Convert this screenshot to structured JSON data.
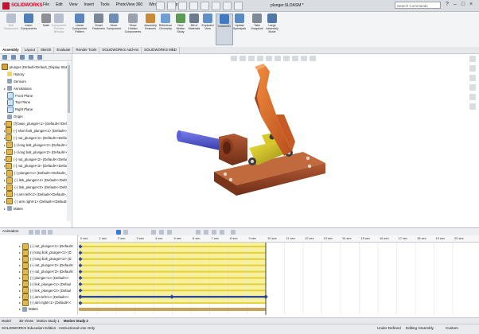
{
  "app": {
    "brand": "SOLIDWORKS",
    "doc_title": "plunger.SLDASM *",
    "search_placeholder": "Search Commands",
    "menu": [
      "File",
      "Edit",
      "View",
      "Insert",
      "Tools",
      "PhotoView 360",
      "Window",
      "Help"
    ],
    "window_buttons": [
      "?",
      "–",
      "□",
      "×"
    ]
  },
  "ribbon": {
    "commands": [
      {
        "label": "Edit\nComponent",
        "color": "#b7c0cc",
        "disabled": true
      },
      {
        "label": "Insert\nComponents",
        "color": "#4f7fb8",
        "disabled": false
      },
      {
        "label": "Mate",
        "color": "#8c8f96",
        "disabled": false
      },
      {
        "label": "Component\nPreview\nWindow",
        "color": "#b7c0cc",
        "disabled": true
      },
      {
        "label": "Linear Component\nPattern",
        "color": "#5b86c0",
        "disabled": false
      },
      {
        "label": "Smart\nFasteners",
        "color": "#7a8796",
        "disabled": false
      },
      {
        "label": "Move\nComponent",
        "color": "#6f8db5",
        "disabled": false
      },
      {
        "label": "Show\nHidden\nComponents",
        "color": "#9aa3ad",
        "disabled": false
      },
      {
        "label": "Assembly\nFeatures",
        "color": "#c98a3a",
        "disabled": false
      },
      {
        "label": "Reference\nGeometry",
        "color": "#6e9fd4",
        "disabled": false
      },
      {
        "label": "New\nMotion\nStudy",
        "color": "#5c9a55",
        "disabled": false
      },
      {
        "label": "Bill of\nMaterials",
        "color": "#6b7c8e",
        "disabled": false
      },
      {
        "label": "Exploded\nView",
        "color": "#5e8fc6",
        "disabled": false
      },
      {
        "label": "Instant3D",
        "color": "#3f7ac4",
        "disabled": false,
        "active": true
      },
      {
        "label": "Update\nSpeedpak",
        "color": "#5a8bc2",
        "disabled": false
      },
      {
        "label": "Take\nSnapshot",
        "color": "#7f8a99",
        "disabled": false
      },
      {
        "label": "Large\nAssembly\nMode",
        "color": "#4f78a8",
        "disabled": false
      }
    ],
    "tabs": [
      "Assembly",
      "Layout",
      "Sketch",
      "Evaluate",
      "Render Tools",
      "SOLIDWORKS Add-Ins",
      "SOLIDWORKS MBD"
    ],
    "active_tab": "Assembly"
  },
  "feature_tree": {
    "root": "plunger (Default<Default_Display State",
    "items": [
      {
        "label": "History",
        "type": "folder",
        "expand": "",
        "indent": 1
      },
      {
        "label": "Sensors",
        "type": "misc",
        "expand": "",
        "indent": 1
      },
      {
        "label": "Annotations",
        "type": "misc",
        "expand": "▸",
        "indent": 1
      },
      {
        "label": "Front Plane",
        "type": "plane",
        "expand": "",
        "indent": 1
      },
      {
        "label": "Top Plane",
        "type": "plane",
        "expand": "",
        "indent": 1
      },
      {
        "label": "Right Plane",
        "type": "plane",
        "expand": "",
        "indent": 1
      },
      {
        "label": "Origin",
        "type": "misc",
        "expand": "",
        "indent": 1
      },
      {
        "label": "(f) base_plunger<1> (Default<<Defaul",
        "type": "part",
        "expand": "▸",
        "indent": 1
      },
      {
        "label": "(-) short bolt_plunger<1> (Default<<D",
        "type": "part",
        "expand": "▸",
        "indent": 1
      },
      {
        "label": "(-) nut_plunger<1> (Default<<Default>",
        "type": "part",
        "expand": "▸",
        "indent": 1
      },
      {
        "label": "(-) long bolt_plunger<1> (Default<<D",
        "type": "part",
        "expand": "▸",
        "indent": 1
      },
      {
        "label": "(-) long bolt_plunger<2> (Default<<D",
        "type": "part",
        "expand": "▸",
        "indent": 1
      },
      {
        "label": "(-) nut_plunger<2> (Default<<Default>",
        "type": "part",
        "expand": "▸",
        "indent": 1
      },
      {
        "label": "(-) nut_plunger<3> (Default<<Default>",
        "type": "part",
        "expand": "▸",
        "indent": 1
      },
      {
        "label": "(-) plunger<1> (Default<<Default>_D",
        "type": "part",
        "expand": "▸",
        "indent": 1
      },
      {
        "label": "(-) link_plunger<1> (Default<<Defaul",
        "type": "part",
        "expand": "▸",
        "indent": 1
      },
      {
        "label": "(-) link_plunger<2> (Default<<Defaul",
        "type": "part",
        "expand": "▸",
        "indent": 1
      },
      {
        "label": "(-) arm left<1> (Default<<Default>_D",
        "type": "part",
        "expand": "▸",
        "indent": 1
      },
      {
        "label": "(-) arm right<1> (Default<<Default>_",
        "type": "part",
        "expand": "▸",
        "indent": 1
      },
      {
        "label": "Mates",
        "type": "misc",
        "expand": "▸",
        "indent": 1
      }
    ]
  },
  "motion": {
    "header_label": "Animation",
    "tree": [
      {
        "label": "(-) nut_plunger<1> (Default<",
        "type": "part"
      },
      {
        "label": "(-) long bolt_plunger<1> (D",
        "type": "part"
      },
      {
        "label": "(-) long bolt_plunger<2> (D",
        "type": "part"
      },
      {
        "label": "(-) nut_plunger<2> (Default<",
        "type": "part"
      },
      {
        "label": "(-) nut_plunger<3> (Default<",
        "type": "part"
      },
      {
        "label": "(-) plunger<1> (Default<<",
        "type": "part"
      },
      {
        "label": "(-) link_plunger<1> (Defaul",
        "type": "part"
      },
      {
        "label": "(-) link_plunger<2> (Defaul",
        "type": "part"
      },
      {
        "label": "(-) arm left<1> (Default<<",
        "type": "part"
      },
      {
        "label": "(-) arm right<1> (Default<<",
        "type": "part"
      },
      {
        "label": "Mates",
        "type": "misc"
      }
    ],
    "ruler": [
      "0 sec",
      "1 sec",
      "2 sec",
      "3 sec",
      "4 sec",
      "5 sec",
      "6 sec",
      "7 sec",
      "8 sec",
      "9 sec",
      "10 sec",
      "11 sec",
      "12 sec",
      "13 sec",
      "14 sec",
      "15 sec",
      "16 sec",
      "17 sec",
      "18 sec",
      "19 sec",
      "20 sec"
    ],
    "tabs": [
      "Model",
      "3D Views",
      "Motion Study 1",
      "Motion Study 2"
    ],
    "active_tab": "Motion Study 2"
  },
  "status": {
    "left": "SOLIDWORKS Education Edition - Instructional Use Only",
    "state": "Under Defined",
    "mode": "Editing Assembly",
    "units": "Custom"
  },
  "colors": {
    "brand_red": "#c8102e",
    "timeline_yellow": "#f7f09c",
    "timeline_bar": "#e5cf3c",
    "timeline_blue": "#2d4a9a",
    "mates_bar": "#c9a25a",
    "base_color": "#9a4a2c",
    "arm_color": "#d96a2c",
    "pin_color": "#5a5fd0",
    "yellow_link": "#e0d02a"
  }
}
